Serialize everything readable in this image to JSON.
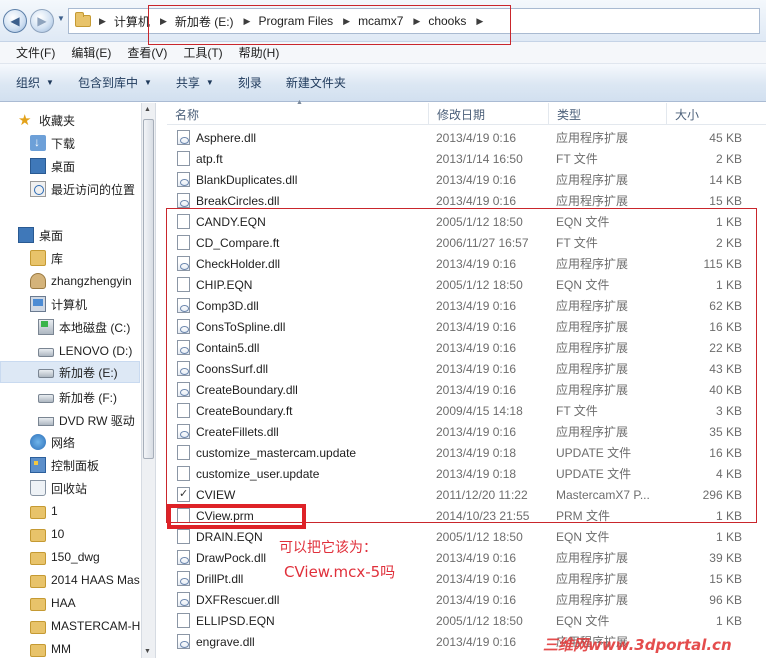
{
  "address": {
    "crumbs": [
      "计算机",
      "新加卷 (E:)",
      "Program Files",
      "mcamx7",
      "chooks"
    ]
  },
  "menu": [
    "文件(F)",
    "编辑(E)",
    "查看(V)",
    "工具(T)",
    "帮助(H)"
  ],
  "commands": {
    "organize": "组织",
    "include_in_library": "包含到库中",
    "share": "共享",
    "burn": "刻录",
    "new_folder": "新建文件夹"
  },
  "nav": {
    "favorites": "收藏夹",
    "downloads": "下载",
    "desktop_fav": "桌面",
    "recent": "最近访问的位置",
    "desktop": "桌面",
    "libraries": "库",
    "user": "zhangzhengyin",
    "computer": "计算机",
    "drive_c": "本地磁盘 (C:)",
    "drive_d": "LENOVO (D:)",
    "drive_e": "新加卷 (E:)",
    "drive_f": "新加卷 (F:)",
    "dvd": "DVD RW 驱动",
    "network": "网络",
    "control_panel": "控制面板",
    "recycle_bin": "回收站",
    "folders": [
      "1",
      "10",
      "150_dwg",
      "2014 HAAS Mas",
      "HAA",
      "MASTERCAM-H",
      "MM"
    ]
  },
  "columns": {
    "name": "名称",
    "modified": "修改日期",
    "type": "类型",
    "size": "大小"
  },
  "files": [
    {
      "name": "Asphere.dll",
      "date": "2013/4/19 0:16",
      "type": "应用程序扩展",
      "size": "45 KB",
      "icon": "dll"
    },
    {
      "name": "atp.ft",
      "date": "2013/1/14 16:50",
      "type": "FT 文件",
      "size": "2 KB",
      "icon": "file"
    },
    {
      "name": "BlankDuplicates.dll",
      "date": "2013/4/19 0:16",
      "type": "应用程序扩展",
      "size": "14 KB",
      "icon": "dll"
    },
    {
      "name": "BreakCircles.dll",
      "date": "2013/4/19 0:16",
      "type": "应用程序扩展",
      "size": "15 KB",
      "icon": "dll"
    },
    {
      "name": "CANDY.EQN",
      "date": "2005/1/12 18:50",
      "type": "EQN 文件",
      "size": "1 KB",
      "icon": "file"
    },
    {
      "name": "CD_Compare.ft",
      "date": "2006/11/27 16:57",
      "type": "FT 文件",
      "size": "2 KB",
      "icon": "file"
    },
    {
      "name": "CheckHolder.dll",
      "date": "2013/4/19 0:16",
      "type": "应用程序扩展",
      "size": "115 KB",
      "icon": "dll"
    },
    {
      "name": "CHIP.EQN",
      "date": "2005/1/12 18:50",
      "type": "EQN 文件",
      "size": "1 KB",
      "icon": "file"
    },
    {
      "name": "Comp3D.dll",
      "date": "2013/4/19 0:16",
      "type": "应用程序扩展",
      "size": "62 KB",
      "icon": "dll"
    },
    {
      "name": "ConsToSpline.dll",
      "date": "2013/4/19 0:16",
      "type": "应用程序扩展",
      "size": "16 KB",
      "icon": "dll"
    },
    {
      "name": "Contain5.dll",
      "date": "2013/4/19 0:16",
      "type": "应用程序扩展",
      "size": "22 KB",
      "icon": "dll"
    },
    {
      "name": "CoonsSurf.dll",
      "date": "2013/4/19 0:16",
      "type": "应用程序扩展",
      "size": "43 KB",
      "icon": "dll"
    },
    {
      "name": "CreateBoundary.dll",
      "date": "2013/4/19 0:16",
      "type": "应用程序扩展",
      "size": "40 KB",
      "icon": "dll"
    },
    {
      "name": "CreateBoundary.ft",
      "date": "2009/4/15 14:18",
      "type": "FT 文件",
      "size": "3 KB",
      "icon": "file"
    },
    {
      "name": "CreateFillets.dll",
      "date": "2013/4/19 0:16",
      "type": "应用程序扩展",
      "size": "35 KB",
      "icon": "dll"
    },
    {
      "name": "customize_mastercam.update",
      "date": "2013/4/19 0:18",
      "type": "UPDATE 文件",
      "size": "16 KB",
      "icon": "file"
    },
    {
      "name": "customize_user.update",
      "date": "2013/4/19 0:18",
      "type": "UPDATE 文件",
      "size": "4 KB",
      "icon": "file"
    },
    {
      "name": "CVIEW",
      "date": "2011/12/20 11:22",
      "type": "MastercamX7 P...",
      "size": "296 KB",
      "icon": "check"
    },
    {
      "name": "CView.prm",
      "date": "2014/10/23 21:55",
      "type": "PRM 文件",
      "size": "1 KB",
      "icon": "file"
    },
    {
      "name": "DRAIN.EQN",
      "date": "2005/1/12 18:50",
      "type": "EQN 文件",
      "size": "1 KB",
      "icon": "file"
    },
    {
      "name": "DrawPock.dll",
      "date": "2013/4/19 0:16",
      "type": "应用程序扩展",
      "size": "39 KB",
      "icon": "dll"
    },
    {
      "name": "DrillPt.dll",
      "date": "2013/4/19 0:16",
      "type": "应用程序扩展",
      "size": "15 KB",
      "icon": "dll"
    },
    {
      "name": "DXFRescuer.dll",
      "date": "2013/4/19 0:16",
      "type": "应用程序扩展",
      "size": "96 KB",
      "icon": "dll"
    },
    {
      "name": "ELLIPSD.EQN",
      "date": "2005/1/12 18:50",
      "type": "EQN 文件",
      "size": "1 KB",
      "icon": "file"
    },
    {
      "name": "engrave.dll",
      "date": "2013/4/19 0:16",
      "type": "应用程序扩展",
      "size": "",
      "icon": "dll"
    }
  ],
  "annotation": {
    "line1": "可以把它该为：",
    "line2": "CView.mcx-5吗"
  },
  "watermark": "三维网www.3dportal.cn"
}
